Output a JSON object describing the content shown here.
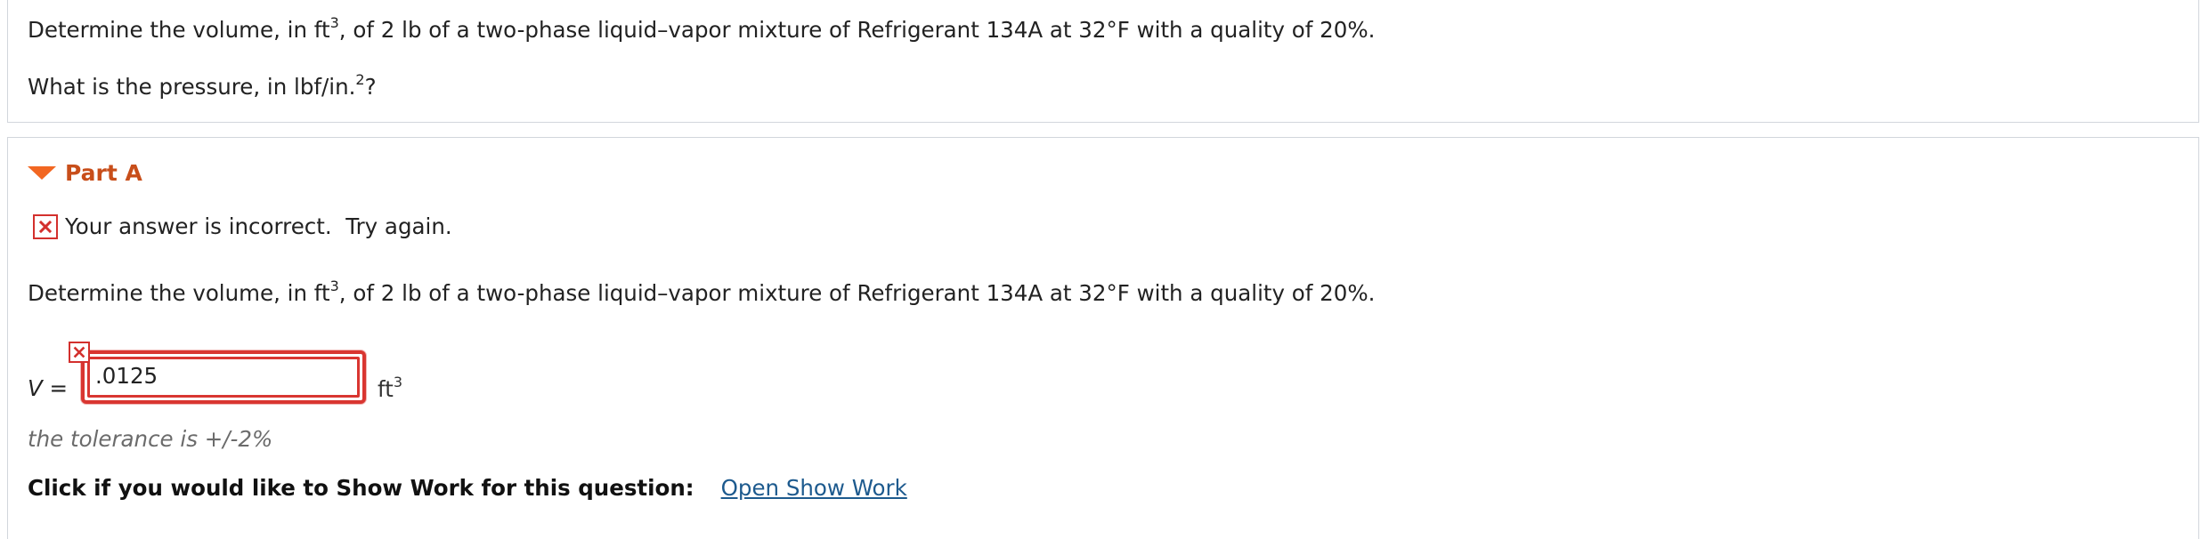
{
  "question": {
    "line1_pre": "Determine the volume, in ft",
    "line1_sup": "3",
    "line1_post": ", of 2 lb of a two-phase liquid–vapor mixture of Refrigerant 134A at 32°F with a quality of 20%.",
    "line2_pre": "What is the pressure, in lbf/in.",
    "line2_sup": "2",
    "line2_post": "?"
  },
  "part": {
    "title": "Part A",
    "feedback": "Your answer is incorrect.  Try again.",
    "prompt_pre": "Determine the volume, in ft",
    "prompt_sup": "3",
    "prompt_post": ", of 2 lb of a two-phase liquid–vapor mixture of Refrigerant 134A at 32°F with a quality of 20%.",
    "variable": "V",
    "equals": " =",
    "answer_value": ".0125",
    "unit_base": "ft",
    "unit_sup": "3",
    "tolerance": "the tolerance is +/-2%",
    "show_work_label": "Click if you would like to Show Work for this question:",
    "show_work_link": "Open Show Work"
  },
  "colors": {
    "accent_orange": "#c84e1a",
    "error_red": "#d3302d",
    "link_blue": "#1d5a8e"
  },
  "icons": {
    "collapse": "triangle-down-icon",
    "error": "x-mark-icon"
  }
}
